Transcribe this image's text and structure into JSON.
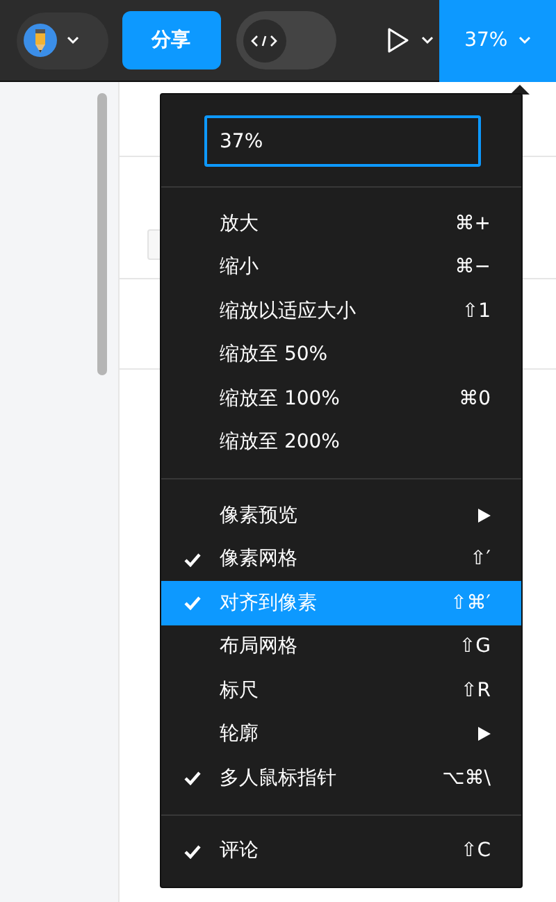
{
  "toolbar": {
    "avatar_menu": {
      "expanded": false
    },
    "share_button": "分享",
    "code_toggle": {
      "on": false
    },
    "play_menu": {
      "expanded": false
    },
    "zoom_button": {
      "label": "37%",
      "selected": true
    }
  },
  "zoom_menu": {
    "input": {
      "value": "37%"
    },
    "sections": [
      [
        {
          "kind": "item",
          "label": "放大",
          "shortcut": "⌘+",
          "checked": false,
          "selected": false
        },
        {
          "kind": "item",
          "label": "缩小",
          "shortcut": "⌘−",
          "checked": false,
          "selected": false
        },
        {
          "kind": "item",
          "label": "缩放以适应大小",
          "shortcut": "⇧1",
          "checked": false,
          "selected": false
        },
        {
          "kind": "item",
          "label": "缩放至 50%",
          "checked": false,
          "selected": false
        },
        {
          "kind": "item",
          "label": "缩放至 100%",
          "shortcut": "⌘0",
          "checked": false,
          "selected": false
        },
        {
          "kind": "item",
          "label": "缩放至 200%",
          "checked": false,
          "selected": false
        }
      ],
      [
        {
          "kind": "submenu",
          "label": "像素预览",
          "checked": false,
          "selected": false
        },
        {
          "kind": "item",
          "label": "像素网格",
          "shortcut": "⇧′",
          "checked": true,
          "selected": false
        },
        {
          "kind": "item",
          "label": "对齐到像素",
          "shortcut": "⇧⌘′",
          "checked": true,
          "selected": true
        },
        {
          "kind": "item",
          "label": "布局网格",
          "shortcut": "⇧G",
          "checked": false,
          "selected": false
        },
        {
          "kind": "item",
          "label": "标尺",
          "shortcut": "⇧R",
          "checked": false,
          "selected": false
        },
        {
          "kind": "submenu",
          "label": "轮廓",
          "checked": false,
          "selected": false
        },
        {
          "kind": "item",
          "label": "多人鼠标指针",
          "shortcut": "⌥⌘\\",
          "checked": true,
          "selected": false
        }
      ],
      [
        {
          "kind": "item",
          "label": "评论",
          "shortcut": "⇧C",
          "checked": true,
          "selected": false
        }
      ]
    ]
  }
}
